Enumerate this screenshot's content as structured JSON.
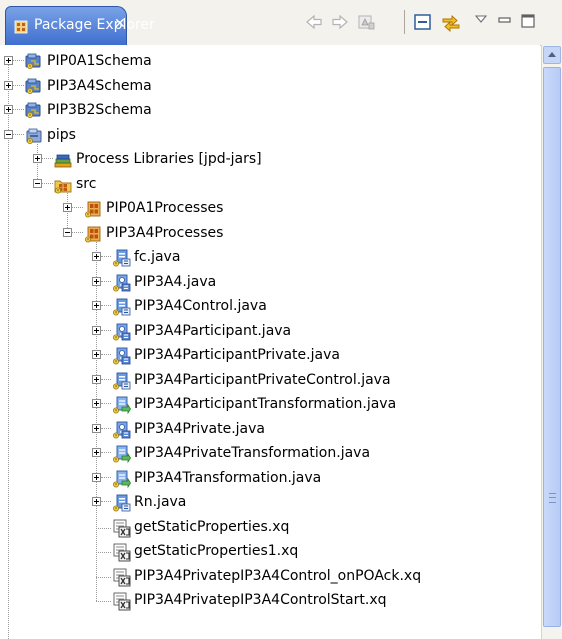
{
  "view": {
    "tab_label": "Package Explorer",
    "tab_close": "✕",
    "toolbar_icons": [
      "back-icon",
      "forward-icon",
      "up-icon",
      "collapse-all-icon",
      "link-with-editor-icon",
      "view-menu-icon",
      "minimize-icon",
      "maximize-icon"
    ]
  },
  "tree": [
    {
      "label": "PIP0A1Schema",
      "depth": 0,
      "expander": "plus",
      "icon": "schema-project-icon"
    },
    {
      "label": "PIP3A4Schema",
      "depth": 0,
      "expander": "plus",
      "icon": "schema-project-icon"
    },
    {
      "label": "PIP3B2Schema",
      "depth": 0,
      "expander": "plus",
      "icon": "schema-project-icon"
    },
    {
      "label": "pips",
      "depth": 0,
      "expander": "minus",
      "icon": "project-icon"
    },
    {
      "label": "Process Libraries [jpd-jars]",
      "depth": 1,
      "expander": "plus",
      "icon": "library-icon"
    },
    {
      "label": "src",
      "depth": 1,
      "expander": "minus",
      "icon": "source-folder-icon"
    },
    {
      "label": "PIP0A1Processes",
      "depth": 2,
      "expander": "plus",
      "icon": "package-icon"
    },
    {
      "label": "PIP3A4Processes",
      "depth": 2,
      "expander": "minus",
      "icon": "package-icon"
    },
    {
      "label": "fc.java",
      "depth": 3,
      "expander": "plus",
      "icon": "control-java-icon"
    },
    {
      "label": "PIP3A4.java",
      "depth": 3,
      "expander": "plus",
      "icon": "process-java-icon"
    },
    {
      "label": "PIP3A4Control.java",
      "depth": 3,
      "expander": "plus",
      "icon": "control-java-icon"
    },
    {
      "label": "PIP3A4Participant.java",
      "depth": 3,
      "expander": "plus",
      "icon": "process-java-icon"
    },
    {
      "label": "PIP3A4ParticipantPrivate.java",
      "depth": 3,
      "expander": "plus",
      "icon": "process-java-icon"
    },
    {
      "label": "PIP3A4ParticipantPrivateControl.java",
      "depth": 3,
      "expander": "plus",
      "icon": "control-java-icon"
    },
    {
      "label": "PIP3A4ParticipantTransformation.java",
      "depth": 3,
      "expander": "plus",
      "icon": "transformation-java-icon"
    },
    {
      "label": "PIP3A4Private.java",
      "depth": 3,
      "expander": "plus",
      "icon": "process-java-icon"
    },
    {
      "label": "PIP3A4PrivateTransformation.java",
      "depth": 3,
      "expander": "plus",
      "icon": "transformation-java-icon"
    },
    {
      "label": "PIP3A4Transformation.java",
      "depth": 3,
      "expander": "plus",
      "icon": "transformation-java-icon"
    },
    {
      "label": "Rn.java",
      "depth": 3,
      "expander": "plus",
      "icon": "control-java-icon"
    },
    {
      "label": "getStaticProperties.xq",
      "depth": 3,
      "expander": "none",
      "icon": "xquery-file-icon"
    },
    {
      "label": "getStaticProperties1.xq",
      "depth": 3,
      "expander": "none",
      "icon": "xquery-file-icon"
    },
    {
      "label": "PIP3A4PrivatepIP3A4Control_onPOAck.xq",
      "depth": 3,
      "expander": "none",
      "icon": "xquery-file-icon"
    },
    {
      "label": "PIP3A4PrivatepIP3A4ControlStart.xq",
      "depth": 3,
      "expander": "none",
      "icon": "xquery-file-icon"
    }
  ],
  "colors": {
    "tab_active": "#4f7ddb",
    "panel_bg": "#f3f2ec",
    "scrollbar_thumb": "#c0d2f8"
  }
}
